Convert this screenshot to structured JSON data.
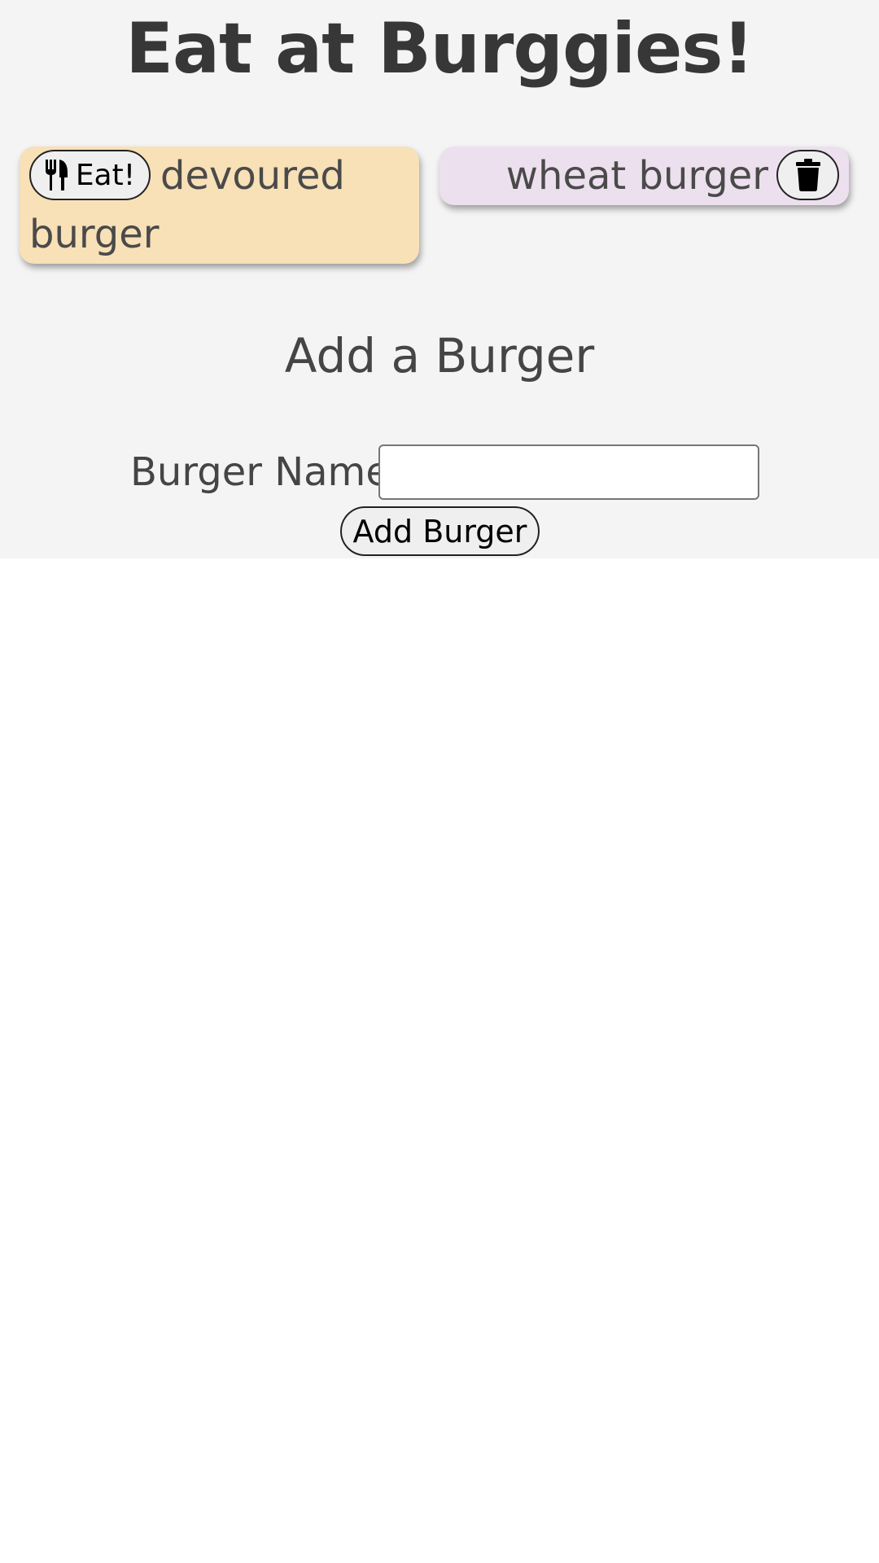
{
  "header": {
    "title": "Eat at Burggies!"
  },
  "burgers": {
    "devoured": [
      {
        "name": "devoured burger",
        "button_label": "Eat!",
        "button_icon": "utensils-icon"
      }
    ],
    "waiting": [
      {
        "name": "wheat burger",
        "button_icon": "trash-icon"
      }
    ]
  },
  "form": {
    "heading": "Add a Burger",
    "label": "Burger Name:",
    "input_value": "",
    "input_placeholder": "",
    "submit_label": "Add Burger"
  },
  "colors": {
    "background": "#f4f4f4",
    "devoured_card": "#f8e0b7",
    "waiting_card": "#ede0ee",
    "text": "#454545"
  }
}
